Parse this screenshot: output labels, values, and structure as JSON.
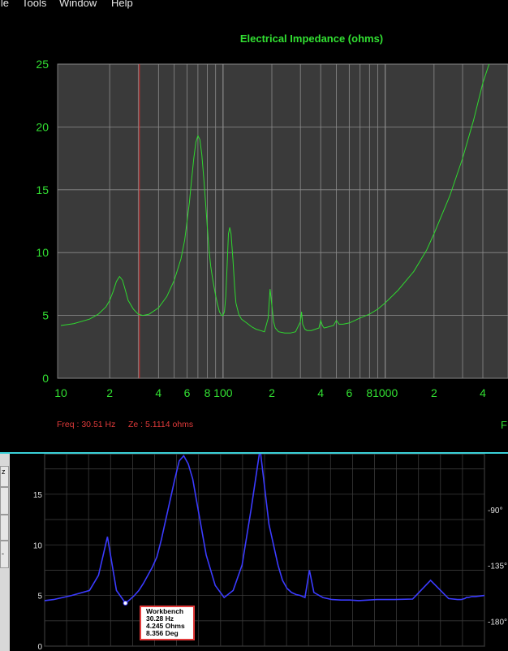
{
  "menu": {
    "items": [
      "ile",
      "Tools",
      "Window",
      "Help"
    ]
  },
  "status": {
    "freq": "Freq : 30.51 Hz",
    "ze": "Ze : 5.1114 ohms",
    "edge_label": "F"
  },
  "left_strip": {
    "labels": [
      "z",
      "",
      "",
      "-"
    ]
  },
  "tooltip": {
    "lines": [
      "Workbench",
      "30.28 Hz",
      "4.245 Ohms",
      "8.356 Deg"
    ]
  },
  "colors": {
    "grid": "#8c8c8c",
    "plot_bg": "#3a3a3a",
    "trace_green": "#2fd82f",
    "trace_blue": "#3b3bff",
    "cursor_red": "#d83030",
    "label_green": "#32e032",
    "status_red": "#e03a3a",
    "divider": "#39d0d8"
  },
  "chart_data": [
    {
      "type": "line",
      "title": "Electrical Impedance (ohms)",
      "x_scale": "log",
      "xlim": [
        10,
        4800
      ],
      "ylim": [
        0,
        25
      ],
      "x_ticks": [
        {
          "v": 10,
          "label": "10"
        },
        {
          "v": 20,
          "label": "2"
        },
        {
          "v": 40,
          "label": "4"
        },
        {
          "v": 60,
          "label": "6"
        },
        {
          "v": 80,
          "label": "8"
        },
        {
          "v": 100,
          "label": "100"
        },
        {
          "v": 200,
          "label": "2"
        },
        {
          "v": 400,
          "label": "4"
        },
        {
          "v": 600,
          "label": "6"
        },
        {
          "v": 800,
          "label": "8"
        },
        {
          "v": 1000,
          "label": "1000"
        },
        {
          "v": 2000,
          "label": "2"
        },
        {
          "v": 4000,
          "label": "4"
        }
      ],
      "y_ticks": [
        0,
        5,
        10,
        15,
        20,
        25
      ],
      "cursor_x": 30.51,
      "series": [
        {
          "x": [
            10,
            12,
            15,
            17,
            19,
            20,
            21,
            22,
            23,
            24,
            25,
            26,
            28,
            30,
            32,
            35,
            40,
            45,
            50,
            55,
            58,
            60,
            62,
            64,
            66,
            68,
            70,
            72,
            74,
            76,
            78,
            80,
            82,
            84,
            86,
            88,
            90,
            92,
            95,
            98,
            100,
            102,
            104,
            106,
            108,
            110,
            112,
            115,
            118,
            120,
            125,
            130,
            140,
            150,
            160,
            170,
            180,
            190,
            195,
            200,
            205,
            210,
            220,
            240,
            260,
            280,
            300,
            305,
            310,
            320,
            330,
            350,
            370,
            390,
            400,
            410,
            420,
            450,
            480,
            500,
            520,
            550,
            600,
            650,
            700,
            800,
            900,
            1000,
            1200,
            1500,
            1800,
            2000,
            2500,
            3000,
            3500,
            4000,
            4500,
            4800
          ],
          "y": [
            4.2,
            4.35,
            4.7,
            5.1,
            5.7,
            6.2,
            6.9,
            7.7,
            8.1,
            7.8,
            7.0,
            6.2,
            5.5,
            5.1,
            5.0,
            5.1,
            5.6,
            6.5,
            7.8,
            9.5,
            11,
            12.5,
            14,
            15.8,
            17.5,
            18.8,
            19.3,
            19.0,
            17.8,
            16,
            14,
            12,
            10.2,
            8.9,
            8.0,
            7.3,
            6.6,
            6.0,
            5.3,
            5.0,
            5.0,
            5.3,
            6.5,
            9,
            11.5,
            12.0,
            11.5,
            9.5,
            7.2,
            6.0,
            5.1,
            4.7,
            4.4,
            4.1,
            3.9,
            3.8,
            3.7,
            4.8,
            7.1,
            5.8,
            4.5,
            4.0,
            3.7,
            3.6,
            3.6,
            3.7,
            4.5,
            5.3,
            4.3,
            3.9,
            3.8,
            3.8,
            3.9,
            4.0,
            4.6,
            4.2,
            4.0,
            4.1,
            4.2,
            4.6,
            4.3,
            4.3,
            4.4,
            4.6,
            4.8,
            5.1,
            5.5,
            6.0,
            7.0,
            8.5,
            10.2,
            11.5,
            14.5,
            17.5,
            20.5,
            23.5,
            25.5,
            26.5
          ]
        }
      ]
    },
    {
      "type": "line",
      "xlim": [
        10,
        500
      ],
      "ylim": [
        0,
        19
      ],
      "y_ticks": [
        0,
        5,
        10,
        15
      ],
      "phase_ticks": [
        {
          "v": -90,
          "label": "-90°"
        },
        {
          "v": -135,
          "label": "-135°"
        },
        {
          "v": -180,
          "label": "-180°"
        }
      ],
      "series": [
        {
          "x": [
            10,
            20,
            40,
            60,
            70,
            80,
            90,
            100,
            105,
            110,
            115,
            120,
            125,
            130,
            135,
            140,
            145,
            150,
            155,
            160,
            165,
            170,
            175,
            180,
            190,
            200,
            210,
            220,
            230,
            240,
            250,
            260,
            270,
            275,
            280,
            285,
            290,
            295,
            300,
            305,
            310,
            320,
            330,
            340,
            350,
            360,
            380,
            400,
            420,
            440,
            460,
            470,
            474,
            478,
            480,
            482,
            486,
            490,
            500
          ],
          "y": [
            4.5,
            4.6,
            5.0,
            5.5,
            7.0,
            10.8,
            5.5,
            4.25,
            4.6,
            5.0,
            5.5,
            6.2,
            7.0,
            7.8,
            8.8,
            10.5,
            12.5,
            14.5,
            16.5,
            18.3,
            18.8,
            18.0,
            16.5,
            14.0,
            9.0,
            6.0,
            4.8,
            5.5,
            8.0,
            13.5,
            19.5,
            12.0,
            8.0,
            6.5,
            5.7,
            5.3,
            5.1,
            5.0,
            4.8,
            7.5,
            5.3,
            4.8,
            4.6,
            4.55,
            4.55,
            4.5,
            4.6,
            4.6,
            4.65,
            6.5,
            4.7,
            4.6,
            4.6,
            4.7,
            4.8,
            4.8,
            4.9,
            4.9,
            5.0
          ]
        }
      ]
    }
  ]
}
